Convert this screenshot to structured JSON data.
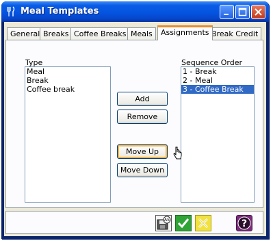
{
  "window": {
    "title": "Meal Templates"
  },
  "tabs": [
    "General",
    "Breaks",
    "Coffee Breaks",
    "Meals",
    "Assignments",
    "Break Credit"
  ],
  "active_tab": "Assignments",
  "type_list": {
    "label": "Type",
    "items": [
      "Meal",
      "Break",
      "Coffee break"
    ]
  },
  "sequence_list": {
    "label": "Sequence Order",
    "items": [
      "1 - Break",
      "2 - Meal",
      "3 - Coffee Break"
    ],
    "selected": "3 - Coffee Break"
  },
  "buttons": {
    "add": "Add",
    "remove": "Remove",
    "move_up": "Move Up",
    "move_down": "Move Down"
  },
  "toolbar": {
    "save_as_badge": "AS",
    "help_glyph": "?"
  },
  "icons": [
    "meal-icon",
    "minimize-icon",
    "maximize-icon",
    "close-icon",
    "save-as-icon",
    "ok-check-icon",
    "cancel-x-icon",
    "help-icon"
  ],
  "colors": {
    "title_bar": "#0454e0",
    "selection": "#316ac5",
    "ok_green": "#2fa336",
    "cancel_yellow": "#f2e23c",
    "help_purple": "#7a2d7a",
    "active_tab_accent": "#e68b2c"
  }
}
